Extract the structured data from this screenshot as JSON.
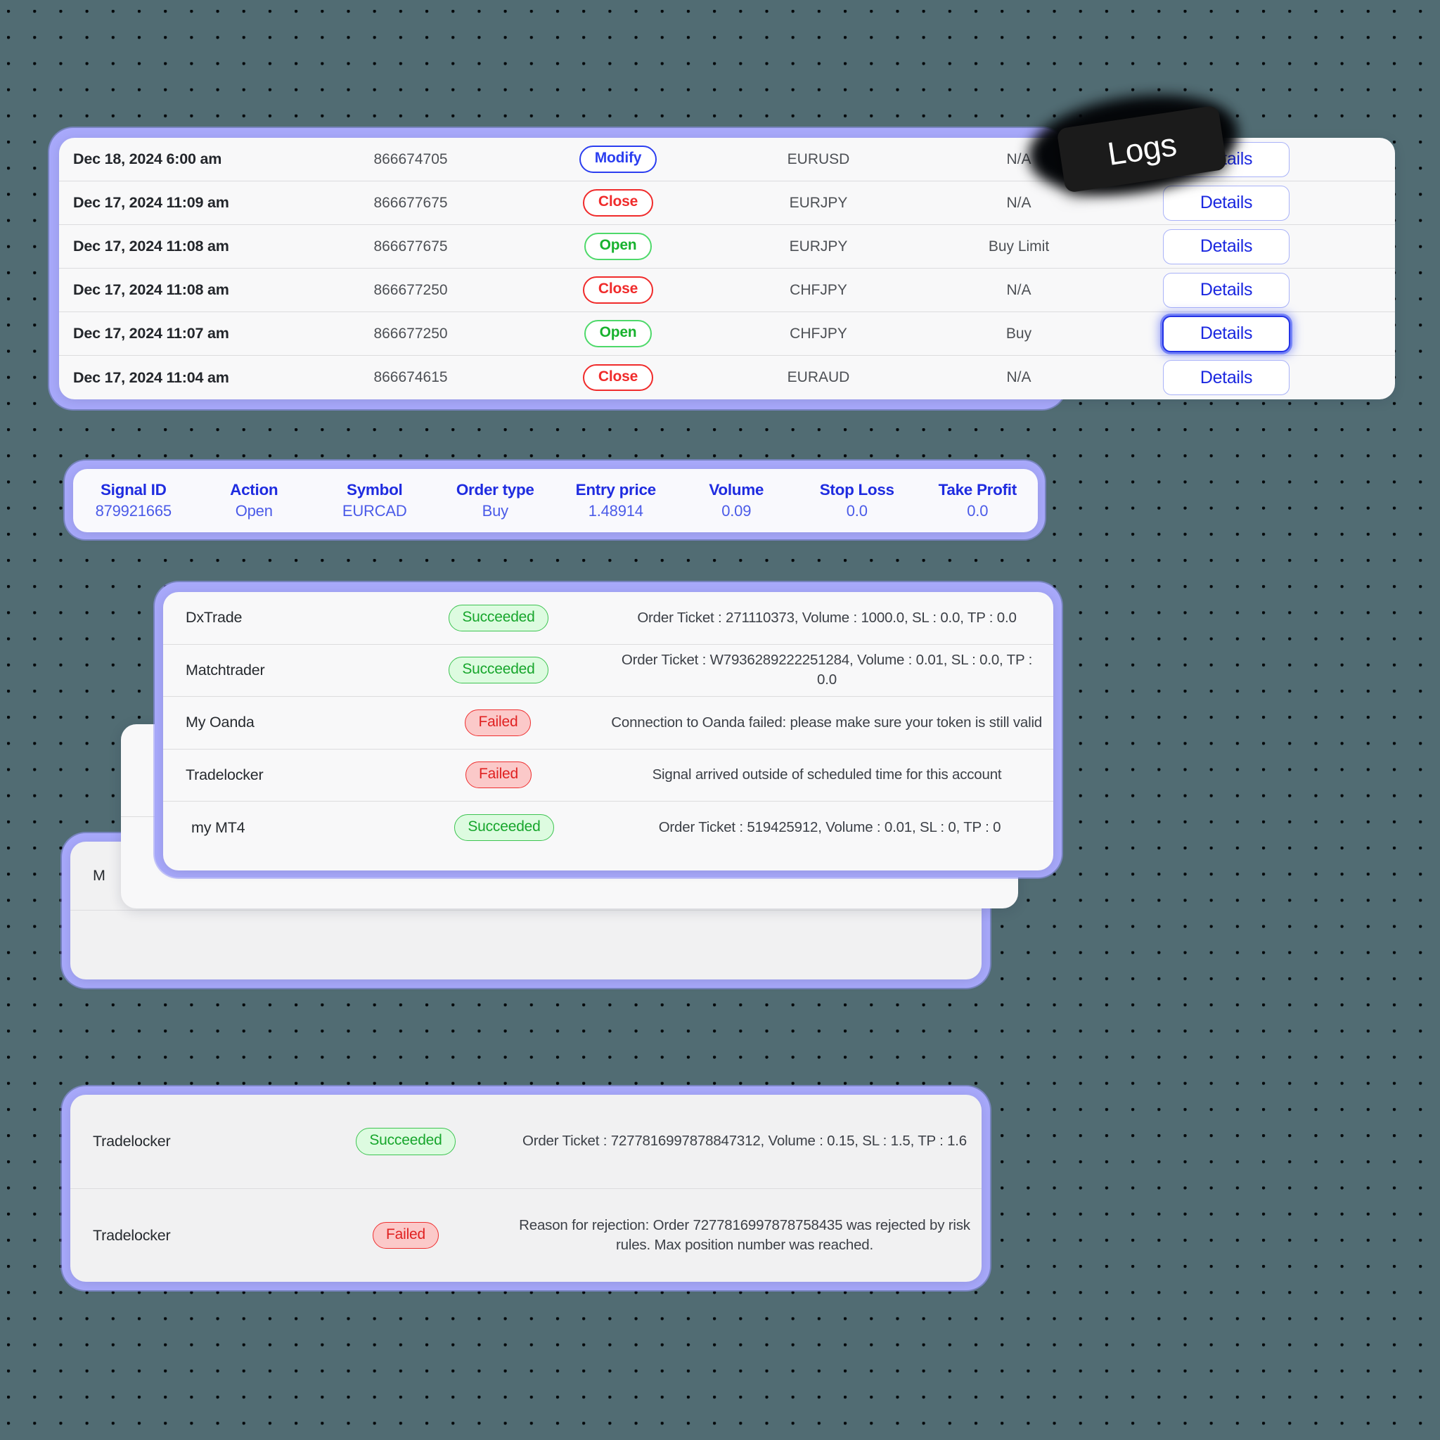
{
  "badge": {
    "label": "Logs"
  },
  "logs_table": {
    "details_label": "Details",
    "rows": [
      {
        "date": "Dec 18, 2024 6:00 am",
        "id": "866674705",
        "action": "Modify",
        "action_kind": "modify",
        "symbol": "EURUSD",
        "order_type": "N/A",
        "details": "Details",
        "focused": false
      },
      {
        "date": "Dec 17, 2024 11:09 am",
        "id": "866677675",
        "action": "Close",
        "action_kind": "close",
        "symbol": "EURJPY",
        "order_type": "N/A",
        "details": "Details",
        "focused": false
      },
      {
        "date": "Dec 17, 2024 11:08 am",
        "id": "866677675",
        "action": "Open",
        "action_kind": "open",
        "symbol": "EURJPY",
        "order_type": "Buy Limit",
        "details": "Details",
        "focused": false
      },
      {
        "date": "Dec 17, 2024 11:08 am",
        "id": "866677250",
        "action": "Close",
        "action_kind": "close",
        "symbol": "CHFJPY",
        "order_type": "N/A",
        "details": "Details",
        "focused": false
      },
      {
        "date": "Dec 17, 2024 11:07 am",
        "id": "866677250",
        "action": "Open",
        "action_kind": "open",
        "symbol": "CHFJPY",
        "order_type": "Buy",
        "details": "Details",
        "focused": true
      },
      {
        "date": "Dec 17, 2024 11:04 am",
        "id": "866674615",
        "action": "Close",
        "action_kind": "close",
        "symbol": "EURAUD",
        "order_type": "N/A",
        "details": "Details",
        "focused": false
      }
    ]
  },
  "signal_summary": {
    "columns": [
      {
        "label": "Signal ID",
        "value": "879921665"
      },
      {
        "label": "Action",
        "value": "Open"
      },
      {
        "label": "Symbol",
        "value": "EURCAD"
      },
      {
        "label": "Order type",
        "value": "Buy"
      },
      {
        "label": "Entry price",
        "value": "1.48914"
      },
      {
        "label": "Volume",
        "value": "0.09"
      },
      {
        "label": "Stop Loss",
        "value": "0.0"
      },
      {
        "label": "Take Profit",
        "value": "0.0"
      }
    ]
  },
  "account_results": {
    "rows": [
      {
        "account": "DxTrade",
        "status": "Succeeded",
        "status_kind": "succeeded",
        "message": "Order Ticket : 271110373, Volume : 1000.0, SL : 0.0, TP : 0.0"
      },
      {
        "account": "Matchtrader",
        "status": "Succeeded",
        "status_kind": "succeeded",
        "message": "Order Ticket : W7936289222251284, Volume : 0.01, SL : 0.0, TP : 0.0"
      },
      {
        "account": "My Oanda",
        "status": "Failed",
        "status_kind": "failed",
        "message": "Connection to Oanda failed: please make sure your token is still valid"
      },
      {
        "account": "Tradelocker",
        "status": "Failed",
        "status_kind": "failed",
        "message": "Signal arrived outside of scheduled time for this account"
      },
      {
        "account": "my MT4",
        "status": "Succeeded",
        "status_kind": "succeeded",
        "message": "Order Ticket : 519425912, Volume : 0.01, SL : 0, TP : 0"
      }
    ]
  },
  "back_results": {
    "rows": [
      {
        "account": "Tradelocker",
        "status": "Succeeded",
        "status_kind": "succeeded",
        "message": "Order Ticket : 7277816997878847312, Volume : 0.15, SL : 1.5, TP : 1.6"
      },
      {
        "account": "Tradelocker",
        "status": "Failed",
        "status_kind": "failed",
        "message": "Reason for rejection: Order 7277816997878758435 was rejected by risk rules. Max position number was reached."
      }
    ]
  },
  "hidden_layer": {
    "partial_label_1": "M",
    "partial_label_2": "M"
  },
  "colors": {
    "accent": "#2b3ef0",
    "success": "#17a62c",
    "danger": "#e02121",
    "frame": "#a8a9fb",
    "background": "#516c73"
  }
}
